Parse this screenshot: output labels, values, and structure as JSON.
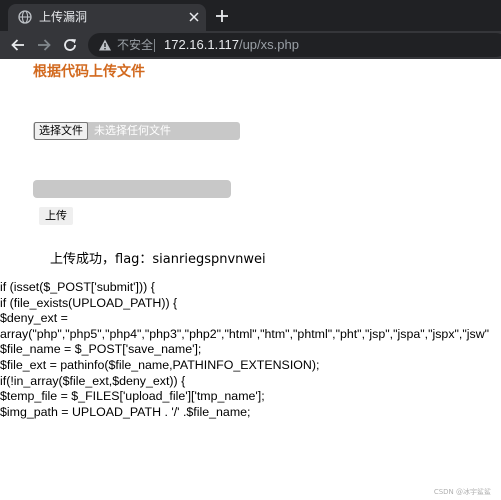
{
  "browser": {
    "tab": {
      "title": "上传漏洞"
    },
    "omnibox": {
      "security_label": "不安全",
      "url_host": "172.16.1.117",
      "url_path": "/up/xs.php"
    }
  },
  "page": {
    "heading": "根据代码上传文件",
    "file_input": {
      "button_label": "选择文件",
      "status": "未选择任何文件"
    },
    "save_name_input": {
      "value": ""
    },
    "submit_label": "上传",
    "result_text": "上传成功，flag：sianriegspnvnwei",
    "code_lines": [
      "if (isset($_POST['submit'])) {",
      "if (file_exists(UPLOAD_PATH)) {",
      "$deny_ext =",
      "array(\"php\",\"php5\",\"php4\",\"php3\",\"php2\",\"html\",\"htm\",\"phtml\",\"pht\",\"jsp\",\"jspa\",\"jspx\",\"jsw\"",
      "$file_name = $_POST['save_name'];",
      "$file_ext = pathinfo($file_name,PATHINFO_EXTENSION);",
      "if(!in_array($file_ext,$deny_ext)) {",
      "$temp_file = $_FILES['upload_file']['tmp_name'];",
      "$img_path = UPLOAD_PATH . '/' .$file_name;"
    ],
    "watermark": "CSDN @冰宇鲨鲨"
  }
}
